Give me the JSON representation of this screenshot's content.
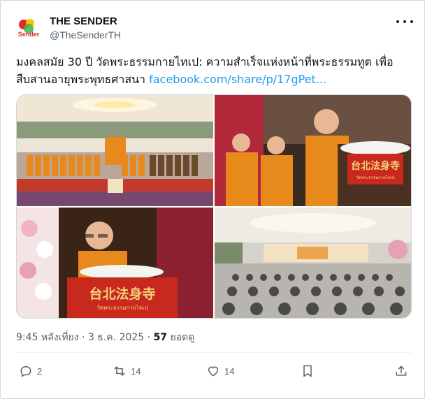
{
  "author": {
    "name": "THE SENDER",
    "handle": "@TheSenderTH",
    "avatar_icon": "the-sender-logo",
    "avatar_logo_text": "Sender"
  },
  "post": {
    "text_line1": "มงคลสมัย 30 ปี วัดพระธรรมกายไทเป: ความสำเร็จแห่งหน้าที่พระธรรมทูต เพื่อ",
    "text_line2": "สืบสานอายุพระพุทธศาสนา",
    "link_text": "facebook.com/share/p/17gPet..."
  },
  "media": {
    "photo_count": 4,
    "sign_chinese": "台北法身寺",
    "sign_thai": "วัดพระธรรมกายไทเป"
  },
  "meta": {
    "time": "9:45 หลังเที่ยง",
    "separator": "·",
    "date": "3 ธ.ค. 2025",
    "views_count": "57",
    "views_label": "ยอดดู"
  },
  "actions": {
    "reply_count": "2",
    "repost_count": "14",
    "like_count": "14"
  },
  "colors": {
    "link": "#1d9bf0",
    "secondary_text": "#536471",
    "primary_text": "#0f1419",
    "robe_orange": "#e8891c",
    "sign_red": "#c8281e"
  }
}
